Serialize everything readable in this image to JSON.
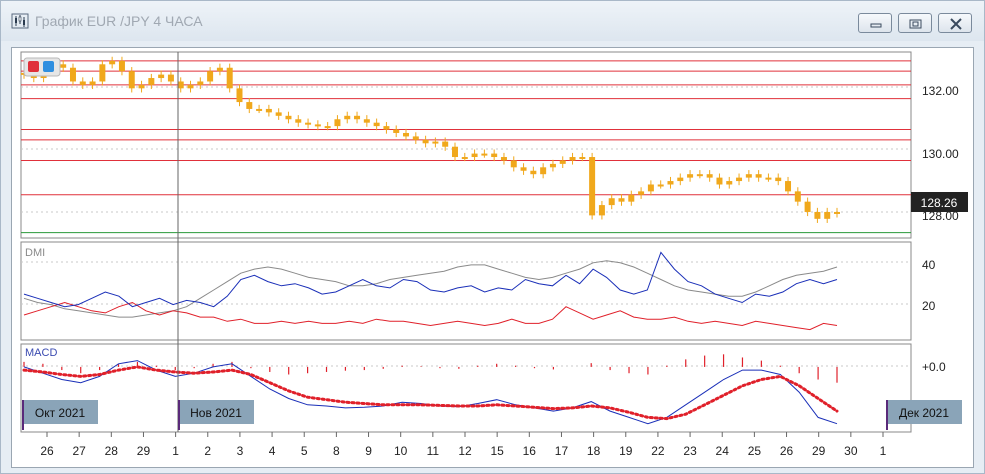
{
  "window": {
    "title": "График EUR /JPY  4 ЧАСА",
    "buttons": [
      "minimize",
      "maximize",
      "close"
    ]
  },
  "price_panel": {
    "y_ticks": [
      "132.00",
      "130.00",
      "128.00"
    ],
    "current_price": "128.26",
    "toggles": [
      {
        "color": "#e0303a"
      },
      {
        "color": "#2f8fe0"
      }
    ]
  },
  "dmi_panel": {
    "label": "DMI",
    "y_ticks": [
      "40",
      "20"
    ]
  },
  "macd_panel": {
    "label": "MACD",
    "y_ticks": [
      "+0.0"
    ]
  },
  "months": [
    "Окт 2021",
    "Нов 2021",
    "Дек 2021"
  ],
  "x_axis": [
    "26",
    "27",
    "28",
    "29",
    "1",
    "2",
    "3",
    "4",
    "5",
    "8",
    "9",
    "10",
    "11",
    "12",
    "15",
    "16",
    "17",
    "18",
    "19",
    "22",
    "23",
    "24",
    "25",
    "26",
    "29",
    "30",
    "1"
  ],
  "colors": {
    "candles": "#f0a81c",
    "levels": "#e0303a",
    "dmi_plus": "#1a2fb8",
    "dmi_minus": "#e0202a",
    "adx": "#8a8a8a",
    "macd_line": "#1a2fb8",
    "macd_signal": "#e0202a",
    "support": "#2a9a3a"
  },
  "chart_data": {
    "type": "line",
    "price": {
      "ylim": [
        127.6,
        132.9
      ],
      "closes": [
        132.3,
        132.2,
        132.5,
        132.6,
        132.5,
        132.1,
        132.0,
        132.1,
        132.6,
        132.7,
        132.4,
        131.9,
        132.0,
        132.2,
        132.3,
        132.1,
        131.9,
        132.0,
        132.1,
        132.4,
        132.5,
        131.9,
        131.5,
        131.3,
        131.3,
        131.2,
        131.1,
        131.0,
        130.9,
        130.85,
        130.8,
        130.8,
        131.0,
        131.1,
        131.0,
        130.9,
        130.8,
        130.7,
        130.6,
        130.5,
        130.4,
        130.3,
        130.35,
        130.2,
        129.9,
        129.9,
        130.0,
        130.0,
        129.9,
        129.8,
        129.6,
        129.5,
        129.4,
        129.6,
        129.7,
        129.8,
        129.9,
        129.9,
        128.2,
        128.5,
        128.7,
        128.6,
        128.8,
        128.9,
        129.1,
        129.1,
        129.2,
        129.3,
        129.4,
        129.4,
        129.3,
        129.1,
        129.2,
        129.3,
        129.4,
        129.3,
        129.3,
        129.2,
        128.9,
        128.6,
        128.3,
        128.1,
        128.3,
        128.26
      ],
      "levels": [
        132.7,
        132.4,
        132.0,
        131.6,
        130.7,
        130.4,
        129.8,
        128.8
      ],
      "support": 127.7
    },
    "dmi": {
      "ylim": [
        5,
        50
      ],
      "plus_di": [
        26,
        24,
        22,
        20,
        21,
        24,
        27,
        25,
        20,
        22,
        24,
        21,
        23,
        22,
        20,
        25,
        33,
        35,
        32,
        30,
        31,
        29,
        26,
        27,
        30,
        33,
        30,
        29,
        33,
        32,
        28,
        27,
        29,
        30,
        27,
        29,
        28,
        33,
        31,
        30,
        35,
        31,
        38,
        34,
        28,
        26,
        28,
        46,
        38,
        32,
        30,
        26,
        24,
        22,
        26,
        25,
        27,
        31,
        33,
        31,
        33
      ],
      "minus_di": [
        16,
        18,
        20,
        22,
        20,
        18,
        17,
        20,
        22,
        18,
        16,
        18,
        17,
        15,
        15,
        13,
        14,
        12,
        12,
        13,
        12,
        13,
        12,
        12,
        13,
        12,
        14,
        13,
        13,
        12,
        11,
        12,
        13,
        12,
        11,
        12,
        14,
        12,
        12,
        14,
        20,
        17,
        14,
        16,
        18,
        15,
        14,
        14,
        15,
        13,
        12,
        13,
        12,
        11,
        13,
        12,
        11,
        10,
        9,
        12,
        11
      ],
      "adx": [
        24,
        22,
        21,
        19,
        18,
        17,
        16,
        15,
        15,
        16,
        17,
        18,
        20,
        24,
        28,
        32,
        36,
        38,
        39,
        38,
        36,
        34,
        33,
        32,
        30,
        30,
        31,
        33,
        34,
        35,
        36,
        37,
        39,
        40,
        40,
        38,
        36,
        34,
        33,
        34,
        36,
        38,
        41,
        42,
        41,
        39,
        36,
        33,
        30,
        28,
        27,
        26,
        25,
        25,
        27,
        30,
        33,
        35,
        36,
        37,
        39
      ]
    },
    "macd": {
      "ylim": [
        -1.0,
        0.3
      ],
      "macd": [
        0.0,
        -0.1,
        -0.2,
        -0.25,
        -0.15,
        0.05,
        0.1,
        -0.05,
        -0.15,
        -0.1,
        0.0,
        0.05,
        -0.15,
        -0.35,
        -0.5,
        -0.6,
        -0.62,
        -0.65,
        -0.64,
        -0.62,
        -0.56,
        -0.58,
        -0.62,
        -0.63,
        -0.58,
        -0.52,
        -0.6,
        -0.65,
        -0.7,
        -0.65,
        -0.55,
        -0.7,
        -0.8,
        -0.9,
        -0.8,
        -0.6,
        -0.4,
        -0.2,
        -0.05,
        -0.05,
        -0.12,
        -0.4,
        -0.8,
        -0.9
      ],
      "signal": [
        -0.05,
        -0.08,
        -0.12,
        -0.15,
        -0.12,
        -0.05,
        0.0,
        -0.05,
        -0.08,
        -0.1,
        -0.08,
        -0.05,
        -0.12,
        -0.25,
        -0.38,
        -0.48,
        -0.52,
        -0.56,
        -0.58,
        -0.6,
        -0.6,
        -0.6,
        -0.61,
        -0.62,
        -0.62,
        -0.6,
        -0.62,
        -0.64,
        -0.66,
        -0.65,
        -0.62,
        -0.65,
        -0.72,
        -0.8,
        -0.82,
        -0.75,
        -0.6,
        -0.45,
        -0.3,
        -0.2,
        -0.15,
        -0.3,
        -0.5,
        -0.7
      ],
      "histogram": [
        0.08,
        0.05,
        -0.05,
        -0.1,
        -0.05,
        0.05,
        0.08,
        0.02,
        -0.05,
        -0.02,
        0.05,
        0.08,
        -0.02,
        -0.08,
        -0.12,
        -0.1,
        -0.08,
        -0.06,
        -0.05,
        -0.03,
        0.02,
        0.01,
        -0.02,
        -0.03,
        0.02,
        0.05,
        0.02,
        -0.02,
        -0.04,
        0.0,
        0.06,
        -0.05,
        -0.1,
        -0.12,
        0.02,
        0.12,
        0.18,
        0.2,
        0.15,
        0.1,
        0.02,
        -0.1,
        -0.2,
        -0.25
      ]
    }
  }
}
